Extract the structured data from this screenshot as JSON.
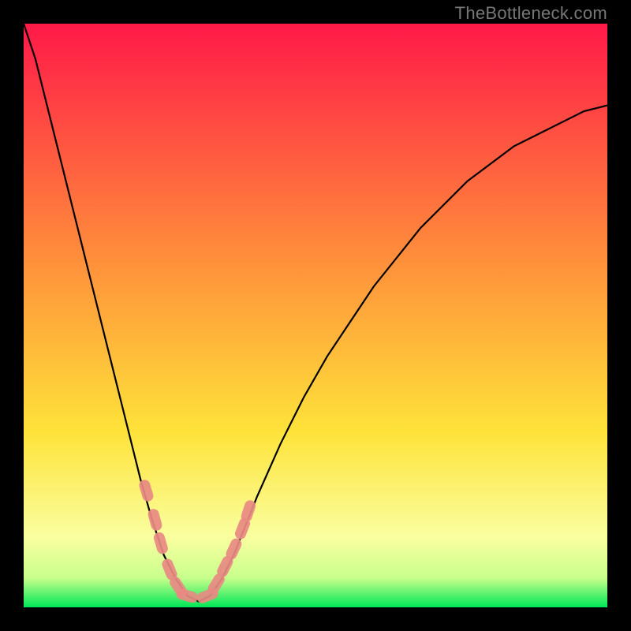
{
  "watermark": "TheBottleneck.com",
  "colors": {
    "frame": "#000000",
    "curve": "#000000",
    "marker": "#E88A83",
    "gradient_top": "#FF1948",
    "gradient_mid1": "#FF8E3B",
    "gradient_mid2": "#FEE33A",
    "gradient_low": "#FAFFA0",
    "gradient_bottom": "#00E757"
  },
  "chart_data": {
    "type": "line",
    "title": "",
    "xlabel": "",
    "ylabel": "",
    "xlim": [
      0,
      100
    ],
    "ylim": [
      0,
      100
    ],
    "series": [
      {
        "name": "bottleneck-curve",
        "x": [
          0,
          2,
          4,
          6,
          8,
          10,
          12,
          14,
          16,
          18,
          20,
          22,
          24,
          26,
          28,
          30,
          32,
          34,
          36,
          38,
          40,
          44,
          48,
          52,
          56,
          60,
          64,
          68,
          72,
          76,
          80,
          84,
          88,
          92,
          96,
          100
        ],
        "y": [
          100,
          94,
          86,
          78,
          70,
          62,
          54,
          46,
          38,
          30,
          22,
          15,
          9,
          5,
          2,
          1,
          2,
          5,
          9,
          14,
          19,
          28,
          36,
          43,
          49,
          55,
          60,
          65,
          69,
          73,
          76,
          79,
          81,
          83,
          85,
          86
        ]
      }
    ],
    "markers": {
      "name": "highlight-points",
      "x": [
        21.0,
        22.5,
        23.5,
        25.0,
        26.5,
        28.0,
        31.5,
        33.0,
        34.5,
        36.0,
        37.5,
        38.5
      ],
      "y": [
        20.0,
        15.0,
        11.0,
        6.5,
        3.5,
        2.0,
        2.0,
        4.0,
        7.0,
        10.0,
        13.5,
        16.5
      ]
    },
    "gradient_stops": [
      {
        "offset": 0.0,
        "color": "#FF1948"
      },
      {
        "offset": 0.4,
        "color": "#FF8E3B"
      },
      {
        "offset": 0.7,
        "color": "#FEE33A"
      },
      {
        "offset": 0.88,
        "color": "#FAFFA0"
      },
      {
        "offset": 0.95,
        "color": "#C8FF8C"
      },
      {
        "offset": 1.0,
        "color": "#00E757"
      }
    ]
  }
}
